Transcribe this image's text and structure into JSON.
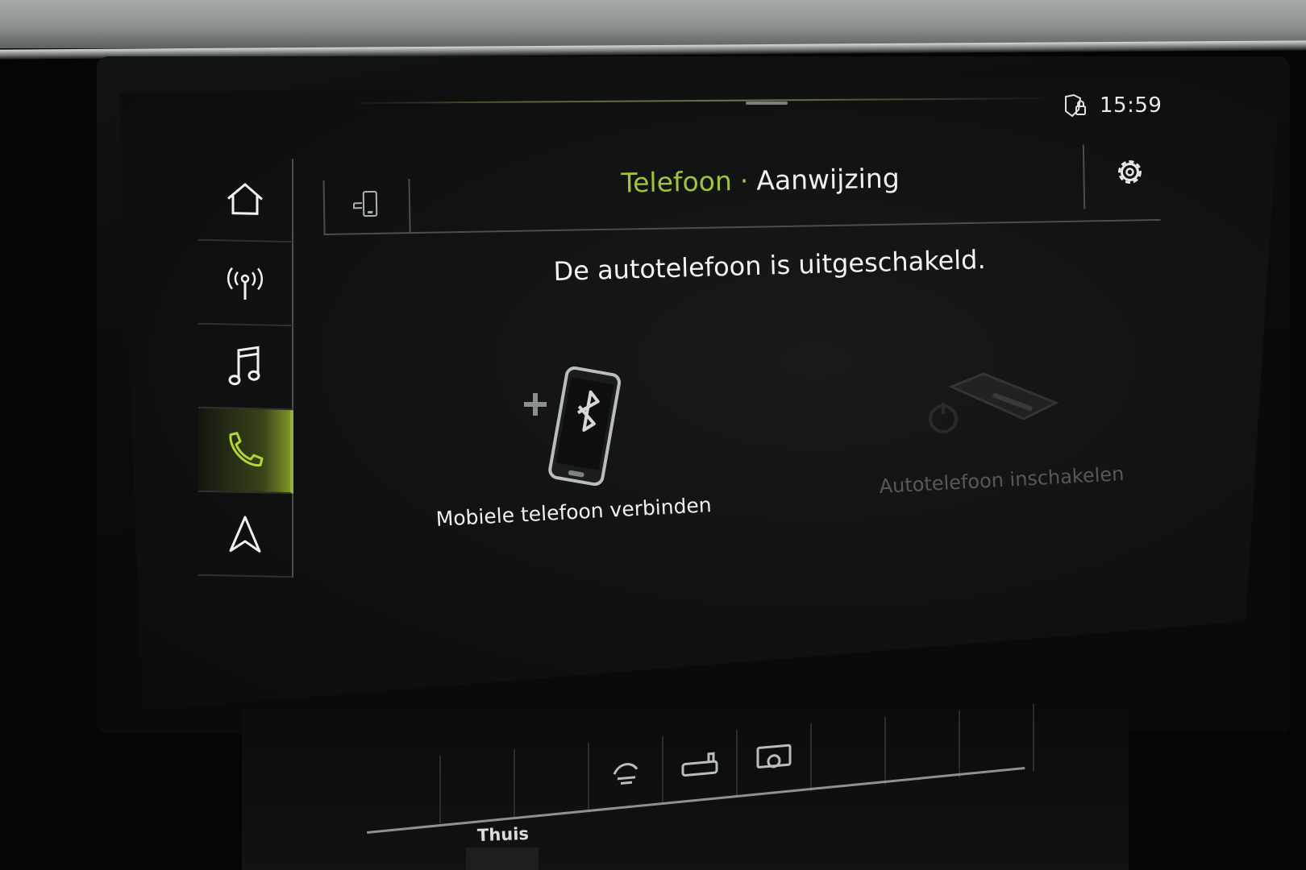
{
  "status_bar": {
    "time": "15:59",
    "status_icon": "shield-lock-icon"
  },
  "sidebar": {
    "items": [
      {
        "icon": "home-icon",
        "active": false
      },
      {
        "icon": "radio-antenna-icon",
        "active": false
      },
      {
        "icon": "music-note-icon",
        "active": false
      },
      {
        "icon": "phone-icon",
        "active": true
      },
      {
        "icon": "navigation-arrow-icon",
        "active": false
      }
    ]
  },
  "header": {
    "crumb_app": "Telefoon",
    "crumb_separator": "·",
    "crumb_page": "Aanwijzing",
    "phone_switch_icon": "phone-switch-icon",
    "settings_icon": "gear-icon"
  },
  "main": {
    "message": "De autotelefoon is uitgeschakeld.",
    "actions": [
      {
        "label": "Mobiele telefoon verbinden",
        "icon": "add-bluetooth-phone-icon",
        "enabled": true
      },
      {
        "label": "Autotelefoon inschakelen",
        "icon": "car-phone-power-icon",
        "enabled": false
      }
    ]
  },
  "lower_console": {
    "label": "Thuis",
    "icons": [
      "fan-icon",
      "seat-heat-icon",
      "display-icon"
    ]
  },
  "colors": {
    "accent": "#a4c23c",
    "text": "#eef0ef",
    "disabled_text": "#8d9190",
    "background": "#101111"
  }
}
